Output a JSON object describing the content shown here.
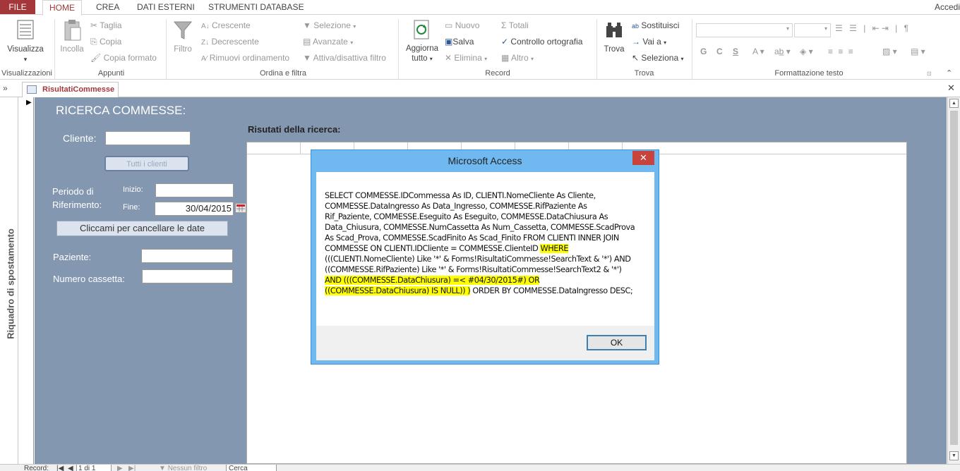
{
  "ribbon_tabs": {
    "file": "FILE",
    "home": "HOME",
    "crea": "CREA",
    "dati_esterni": "DATI ESTERNI",
    "strumenti": "STRUMENTI DATABASE"
  },
  "account": "Accedi",
  "ribbon": {
    "visualizza": "Visualizza",
    "visualizzazioni": "Visualizzazioni",
    "incolla": "Incolla",
    "taglia": "Taglia",
    "copia": "Copia",
    "copia_formato": "Copia formato",
    "appunti": "Appunti",
    "filtro": "Filtro",
    "crescente": "Crescente",
    "decrescente": "Decrescente",
    "rimuovi_ordinamento": "Rimuovi ordinamento",
    "selezione": "Selezione",
    "avanzate": "Avanzate",
    "attiva_filtro": "Attiva/disattiva filtro",
    "ordina_filtra": "Ordina e filtra",
    "aggiorna": "Aggiorna",
    "tutto": "tutto",
    "nuovo": "Nuovo",
    "salva": "Salva",
    "elimina": "Elimina",
    "totali": "Totali",
    "controllo": "Controllo ortografia",
    "altro": "Altro",
    "record": "Record",
    "trova": "Trova",
    "sostituisci": "Sostituisci",
    "vai_a": "Vai a",
    "seleziona": "Seleziona",
    "trova_group": "Trova",
    "g": "G",
    "c": "C",
    "s": "S",
    "a": "A",
    "formattazione": "Formattazione testo"
  },
  "doc_tab": "RisultatiCommesse",
  "nav_pane": "Riquadro di spostamento",
  "form": {
    "title": "RICERCA COMMESSE:",
    "cliente_label": "Cliente:",
    "tutti_button": "Tutti i clienti",
    "periodo_label1": "Periodo di",
    "periodo_label2": "Riferimento:",
    "inizio_label": "Inizio:",
    "fine_label": "Fine:",
    "fine_value": "30/04/2015",
    "cancel_dates_button": "Cliccami per cancellare le date",
    "paziente_label": "Paziente:",
    "cassetta_label": "Numero cassetta:",
    "results_label": "Risutati della ricerca:"
  },
  "statusbar": {
    "record": "Record:",
    "position": "1 di 1",
    "no_filter": "Nessun filtro",
    "search": "Cerca"
  },
  "dialog": {
    "title": "Microsoft Access",
    "close": "✕",
    "sql_part1": "SELECT COMMESSE.IDCommessa As ID, CLIENTI.NomeCliente As Cliente, COMMESSE.DataIngresso As Data_Ingresso, COMMESSE.RifPaziente As Rif_Paziente, COMMESSE.Eseguito As Eseguito, COMMESSE.DataChiusura As Data_Chiusura, COMMESSE.NumCassetta As Num_Cassetta, COMMESSE.ScadProva As Scad_Prova, COMMESSE.ScadFinito As Scad_Finito FROM CLIENTI INNER JOIN COMMESSE ON CLIENTI.IDCliente = COMMESSE.ClienteID ",
    "sql_where": "WHERE",
    "sql_part2": " (((CLIENTI.NomeCliente) Like '*' & Forms!RisultatiCommesse!SearchText & '*') AND ((COMMESSE.RifPaziente) Like '*' & Forms!RisultatiCommesse!SearchText2 & '*') ",
    "sql_highlight": " AND (((COMMESSE.DataChiusura) =< #04/30/2015#) OR ((COMMESSE.DataChiusura) IS NULL)) )",
    "sql_part3": " ORDER BY COMMESSE.DataIngresso DESC;",
    "ok": "OK"
  }
}
